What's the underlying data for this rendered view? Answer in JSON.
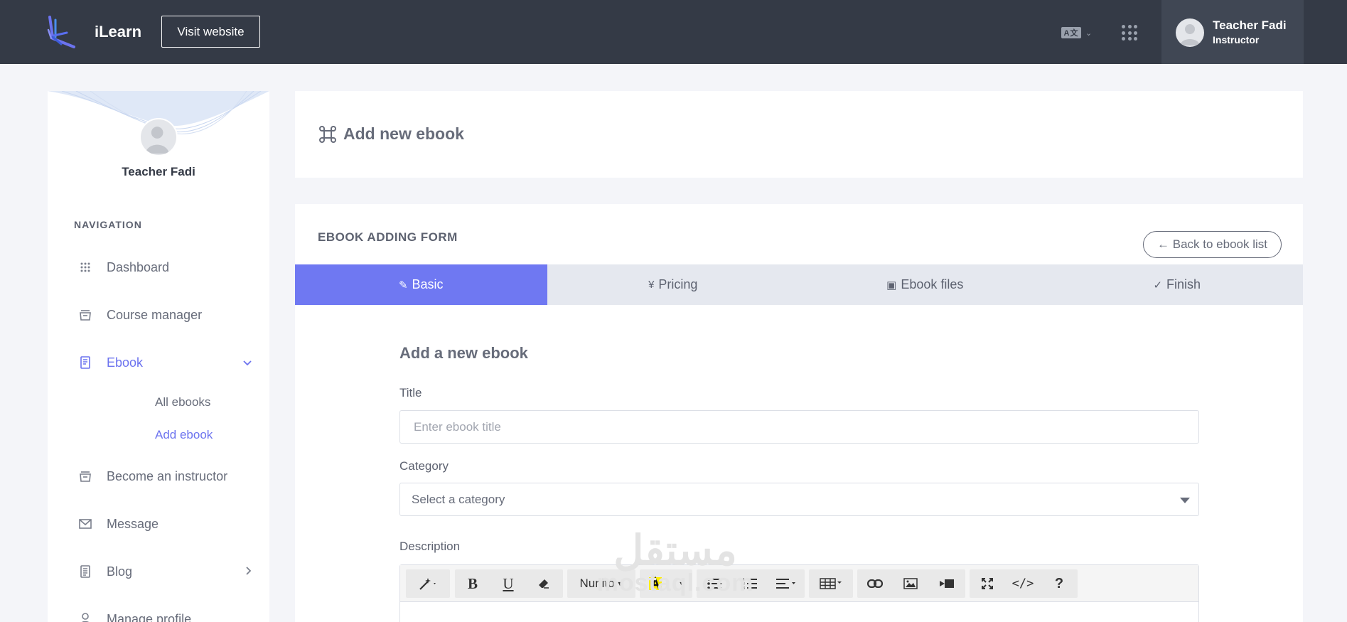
{
  "header": {
    "brand": "iLearn",
    "visit_label": "Visit website",
    "user_name": "Teacher Fadi",
    "user_role": "Instructor",
    "lang_icon_text": "A文"
  },
  "sidebar": {
    "profile_name": "Teacher Fadi",
    "nav_heading": "NAVIGATION",
    "items": [
      {
        "label": "Dashboard",
        "icon": "grid-icon"
      },
      {
        "label": "Course manager",
        "icon": "inbox-icon"
      },
      {
        "label": "Ebook",
        "icon": "book-icon",
        "active": true,
        "expanded": true
      },
      {
        "label": "Become an instructor",
        "icon": "inbox-icon"
      },
      {
        "label": "Message",
        "icon": "mail-icon"
      },
      {
        "label": "Blog",
        "icon": "document-icon"
      },
      {
        "label": "Manage profile",
        "icon": "user-icon"
      }
    ],
    "ebook_sub": [
      {
        "label": "All ebooks"
      },
      {
        "label": "Add ebook",
        "active": true
      }
    ]
  },
  "page": {
    "title": "Add new ebook",
    "form_title": "EBOOK ADDING FORM",
    "back_label": "← Back to ebook list",
    "steps": [
      {
        "label": "Basic",
        "icon": "✎",
        "active": true
      },
      {
        "label": "Pricing",
        "icon": "¥"
      },
      {
        "label": "Ebook files",
        "icon": "▣"
      },
      {
        "label": "Finish",
        "icon": "✓"
      }
    ],
    "section_title": "Add a new ebook",
    "title_label": "Title",
    "title_placeholder": "Enter ebook title",
    "category_label": "Category",
    "category_value": "Select a category",
    "description_label": "Description",
    "editor_font": "Nunito"
  },
  "watermark": {
    "arabic": "مستقل",
    "latin": "mostaql.com"
  },
  "colors": {
    "topbar": "#343a46",
    "accent": "#6c73ef",
    "active_step": "#6f78f2",
    "steps_bg": "#e5e8ef"
  }
}
